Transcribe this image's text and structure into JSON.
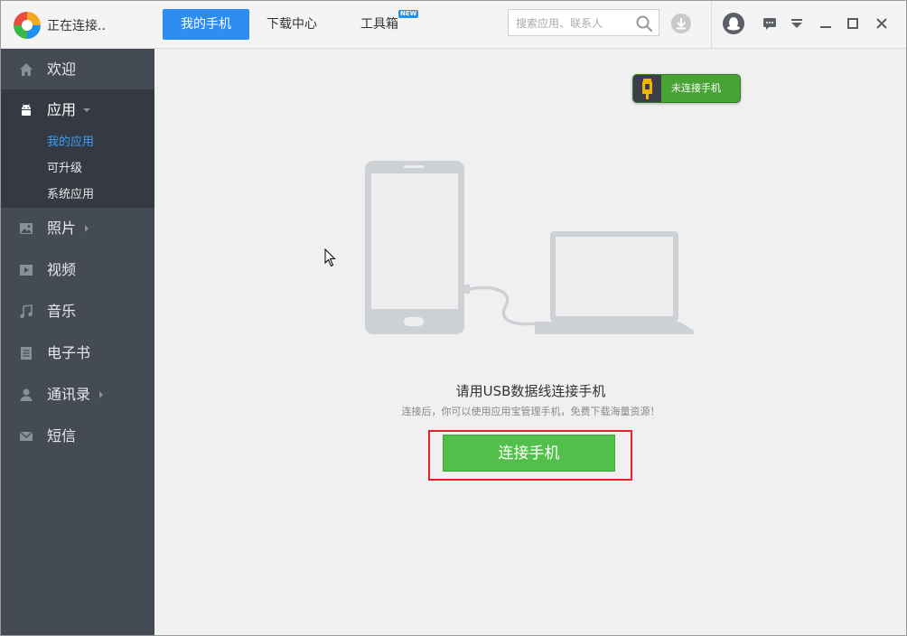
{
  "app": {
    "title": "正在连接.."
  },
  "tabs": [
    {
      "label": "我的手机",
      "active": true
    },
    {
      "label": "下载中心",
      "active": false
    },
    {
      "label": "工具箱",
      "active": false,
      "badge": "NEW"
    }
  ],
  "search": {
    "placeholder": "搜索应用、联系人"
  },
  "sidebar": {
    "items": [
      {
        "label": "欢迎",
        "icon": "home-icon"
      },
      {
        "label": "应用",
        "icon": "android-icon",
        "expanded": true
      },
      {
        "label": "照片",
        "icon": "photo-icon"
      },
      {
        "label": "视频",
        "icon": "video-icon"
      },
      {
        "label": "音乐",
        "icon": "music-icon"
      },
      {
        "label": "电子书",
        "icon": "ebook-icon"
      },
      {
        "label": "通讯录",
        "icon": "contacts-icon"
      },
      {
        "label": "短信",
        "icon": "sms-icon"
      }
    ],
    "app_sub_items": [
      {
        "label": "我的应用",
        "active": true
      },
      {
        "label": "可升级",
        "active": false
      },
      {
        "label": "系统应用",
        "active": false
      }
    ]
  },
  "status": {
    "label": "未连接手机"
  },
  "main": {
    "connect_title": "请用USB数据线连接手机",
    "connect_desc": "连接后，你可以使用应用宝管理手机，免费下载海量资源！",
    "connect_button": "连接手机"
  },
  "colors": {
    "accent": "#2d8df0",
    "sidebar_bg": "#444b55",
    "sidebar_active_bg": "#353a42",
    "button_green": "#52bf4a",
    "highlight_red": "#e8202a",
    "link_blue": "#3d9cff"
  }
}
